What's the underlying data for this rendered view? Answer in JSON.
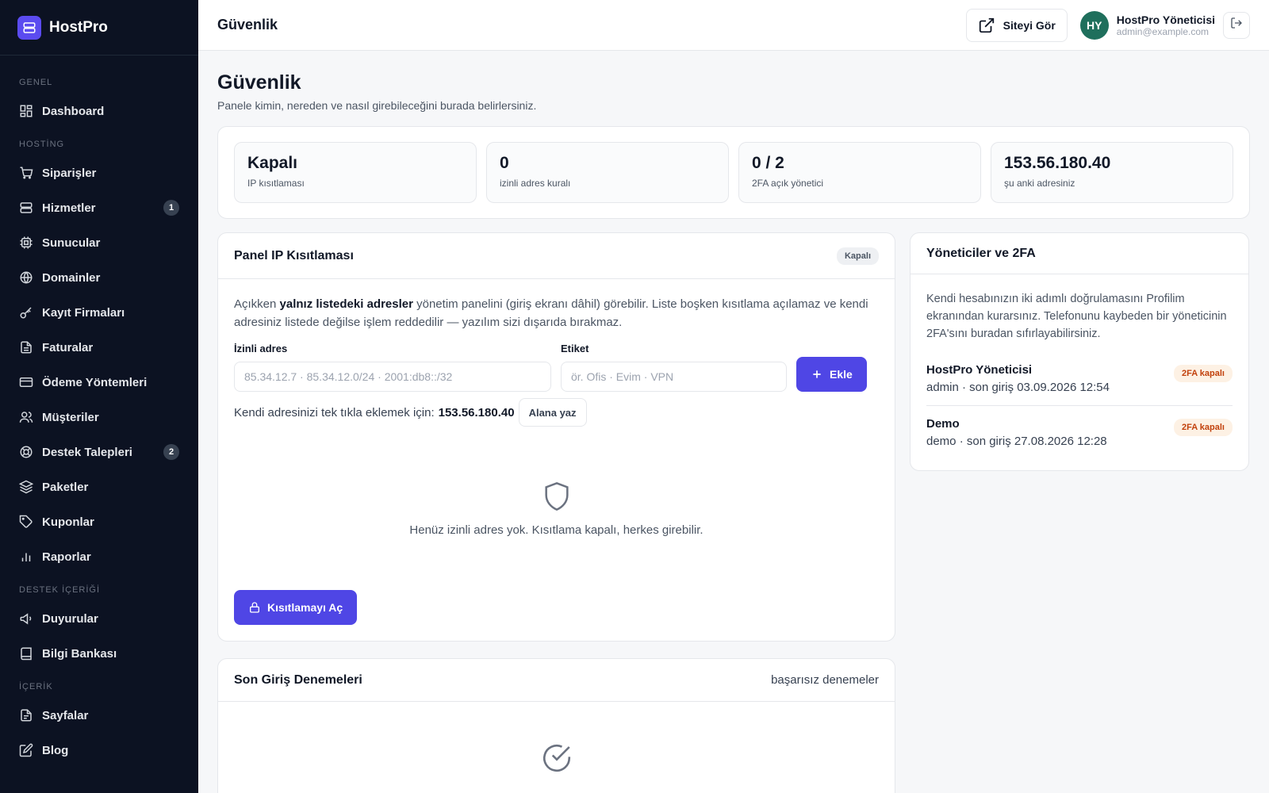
{
  "brand": {
    "name": "HostPro"
  },
  "sidebar": {
    "sections": [
      {
        "title": "GENEL",
        "items": [
          {
            "label": "Dashboard",
            "icon": "dashboard-icon",
            "badge": null
          }
        ]
      },
      {
        "title": "HOSTİNG",
        "items": [
          {
            "label": "Siparişler",
            "icon": "cart-icon",
            "badge": null
          },
          {
            "label": "Hizmetler",
            "icon": "server-icon",
            "badge": "1"
          },
          {
            "label": "Sunucular",
            "icon": "cpu-icon",
            "badge": null
          },
          {
            "label": "Domainler",
            "icon": "globe-icon",
            "badge": null
          },
          {
            "label": "Kayıt Firmaları",
            "icon": "key-icon",
            "badge": null
          },
          {
            "label": "Faturalar",
            "icon": "invoice-icon",
            "badge": null
          },
          {
            "label": "Ödeme Yöntemleri",
            "icon": "credit-card-icon",
            "badge": null
          },
          {
            "label": "Müşteriler",
            "icon": "users-icon",
            "badge": null
          },
          {
            "label": "Destek Talepleri",
            "icon": "lifebuoy-icon",
            "badge": "2"
          },
          {
            "label": "Paketler",
            "icon": "layers-icon",
            "badge": null
          },
          {
            "label": "Kuponlar",
            "icon": "tag-icon",
            "badge": null
          },
          {
            "label": "Raporlar",
            "icon": "bar-chart-icon",
            "badge": null
          }
        ]
      },
      {
        "title": "DESTEK İÇERİĞİ",
        "items": [
          {
            "label": "Duyurular",
            "icon": "megaphone-icon",
            "badge": null
          },
          {
            "label": "Bilgi Bankası",
            "icon": "book-icon",
            "badge": null
          }
        ]
      },
      {
        "title": "İÇERİK",
        "items": [
          {
            "label": "Sayfalar",
            "icon": "page-icon",
            "badge": null
          },
          {
            "label": "Blog",
            "icon": "edit-icon",
            "badge": null
          }
        ]
      }
    ]
  },
  "header": {
    "title": "Güvenlik",
    "view_site_label": "Siteyi Gör",
    "user": {
      "initials": "HY",
      "name": "HostPro Yöneticisi",
      "email": "admin@example.com"
    }
  },
  "page": {
    "title": "Güvenlik",
    "subtitle": "Panele kimin, nereden ve nasıl girebileceğini burada belirlersiniz."
  },
  "stats": [
    {
      "value": "Kapalı",
      "label": "IP kısıtlaması"
    },
    {
      "value": "0",
      "label": "izinli adres kuralı"
    },
    {
      "value": "0 / 2",
      "label": "2FA açık yönetici"
    },
    {
      "value": "153.56.180.40",
      "label": "şu anki adresiniz"
    }
  ],
  "ip_panel": {
    "title": "Panel IP Kısıtlaması",
    "status": "Kapalı",
    "desc_pre": "Açıkken",
    "desc_bold": "yalnız listedeki adresler",
    "desc_post": "yönetim panelini (giriş ekranı dâhil) görebilir. Liste boşken kısıtlama açılamaz ve kendi adresiniz listede değilse işlem reddedilir — yazılım sizi dışarıda bırakmaz.",
    "address_label": "İzinli adres",
    "address_placeholder": "85.34.12.7 · 85.34.12.0/24 · 2001:db8::/32",
    "tag_label": "Etiket",
    "tag_placeholder": "ör. Ofis · Evim · VPN",
    "add_label": "Ekle",
    "quick_text": "Kendi adresinizi tek tıkla eklemek için:",
    "quick_ip": "153.56.180.40",
    "quick_button": "Alana yaz",
    "empty_text": "Henüz izinli adres yok. Kısıtlama kapalı, herkes girebilir.",
    "enable_label": "Kısıtlamayı Aç"
  },
  "admins_panel": {
    "title": "Yöneticiler ve 2FA",
    "desc": "Kendi hesabınızın iki adımlı doğrulamasını Profilim ekranından kurarsınız. Telefonunu kaybeden bir yöneticinin 2FA'sını buradan sıfırlayabilirsiniz.",
    "admins": [
      {
        "name": "HostPro Yöneticisi",
        "meta": "admin · son giriş 03.09.2026 12:54",
        "badge": "2FA kapalı"
      },
      {
        "name": "Demo",
        "meta": "demo · son giriş 27.08.2026 12:28",
        "badge": "2FA kapalı"
      }
    ]
  },
  "login_attempts": {
    "title": "Son Giriş Denemeleri",
    "subtitle": "başarısız denemeler"
  },
  "colors": {
    "accent": "#4f46e5",
    "sidebar": "#0c1222",
    "badge_orange": "#c2410c"
  }
}
